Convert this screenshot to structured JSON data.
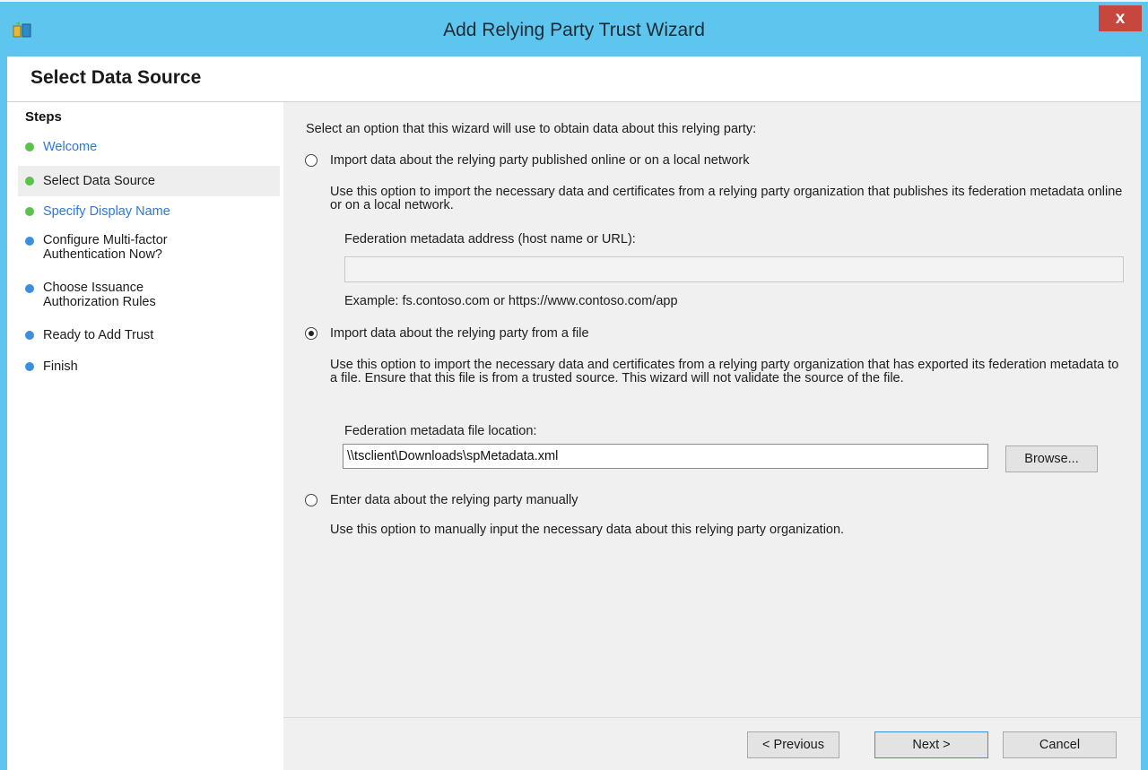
{
  "window": {
    "title": "Add Relying Party Trust Wizard",
    "close_label": "x",
    "accent_color": "#5ec6ee"
  },
  "header": {
    "page_title": "Select Data Source"
  },
  "steps": {
    "heading": "Steps",
    "items": [
      {
        "label": "Welcome",
        "status": "completed"
      },
      {
        "label": "Select Data Source",
        "status": "current"
      },
      {
        "label": "Specify Display Name",
        "status": "upcoming-link"
      },
      {
        "label": "Configure Multi-factor Authentication Now?",
        "status": "upcoming"
      },
      {
        "label": "Choose Issuance Authorization Rules",
        "status": "upcoming"
      },
      {
        "label": "Ready to Add Trust",
        "status": "upcoming"
      },
      {
        "label": "Finish",
        "status": "upcoming"
      }
    ]
  },
  "main": {
    "intro": "Select an option that this wizard will use to obtain data about this relying party:",
    "option_online": {
      "label": "Import data about the relying party published online or on a local network",
      "description": "Use this option to import the necessary data and certificates from a relying party organization that publishes its federation metadata online or on a local network.",
      "field_label": "Federation metadata address (host name or URL):",
      "field_value": "",
      "example": "Example: fs.contoso.com or https://www.contoso.com/app",
      "selected": false
    },
    "option_file": {
      "label": "Import data about the relying party from a file",
      "description": "Use this option to import the necessary data and certificates from a relying party organization that has exported its federation metadata to a file. Ensure that this file is from a trusted source.  This wizard will not validate the source of the file.",
      "field_label": "Federation metadata file location:",
      "field_value": "\\\\tsclient\\Downloads\\spMetadata.xml",
      "browse_label": "Browse...",
      "selected": true
    },
    "option_manual": {
      "label": "Enter data about the relying party manually",
      "description": "Use this option to manually input the necessary data about this relying party organization.",
      "selected": false
    }
  },
  "footer": {
    "previous_label": "< Previous",
    "next_label": "Next >",
    "cancel_label": "Cancel"
  }
}
